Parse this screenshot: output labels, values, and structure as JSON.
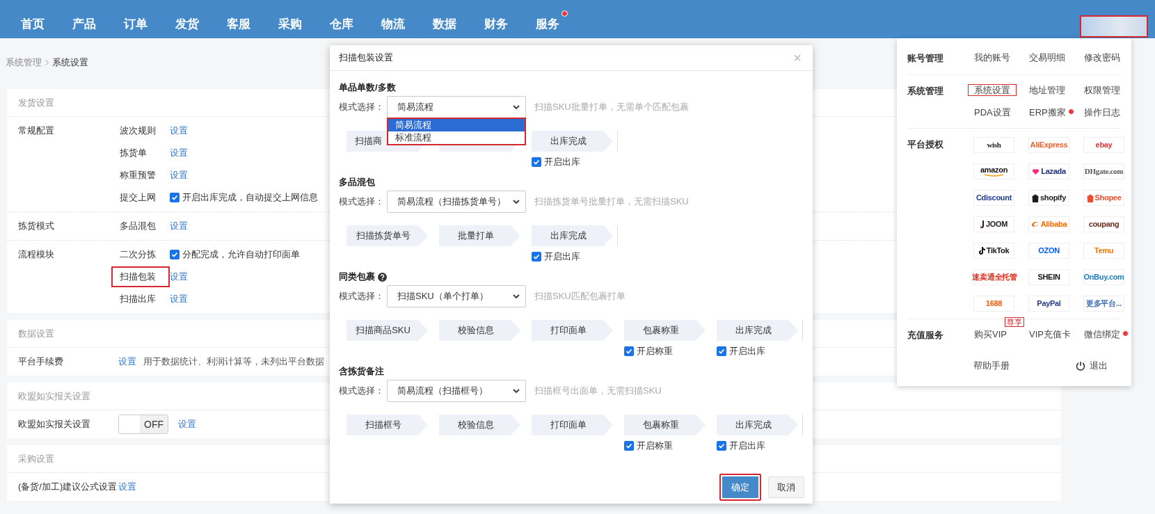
{
  "nav": {
    "items": [
      {
        "label": "首页",
        "dot": false
      },
      {
        "label": "产品",
        "dot": false
      },
      {
        "label": "订单",
        "dot": false
      },
      {
        "label": "发货",
        "dot": false
      },
      {
        "label": "客服",
        "dot": false
      },
      {
        "label": "采购",
        "dot": false
      },
      {
        "label": "仓库",
        "dot": false
      },
      {
        "label": "物流",
        "dot": false
      },
      {
        "label": "数据",
        "dot": false
      },
      {
        "label": "财务",
        "dot": false
      },
      {
        "label": "服务",
        "dot": true
      }
    ],
    "account": {
      "highlighted": true
    }
  },
  "breadcrumb": [
    {
      "label": "系统管理",
      "current": false
    },
    {
      "label": "系统设置",
      "current": true
    }
  ],
  "sections": [
    {
      "title": "发货设置",
      "groups": [
        {
          "label": "常规配置",
          "rows": [
            {
              "kind": "link",
              "name": "波次规则",
              "link": "设置"
            },
            {
              "kind": "link",
              "name": "拣货单",
              "link": "设置"
            },
            {
              "kind": "link",
              "name": "称重预警",
              "link": "设置"
            },
            {
              "kind": "check",
              "name": "提交上网",
              "checked": true,
              "text": "开启出库完成，自动提交上网信息"
            }
          ]
        },
        {
          "label": "拣货模式",
          "rows": [
            {
              "kind": "link",
              "name": "多品混包",
              "link": "设置"
            }
          ]
        },
        {
          "label": "流程模块",
          "rows": [
            {
              "kind": "check",
              "name": "二次分拣",
              "checked": true,
              "text": "分配完成，允许自动打印面单"
            },
            {
              "kind": "link",
              "name": "扫描包装",
              "link": "设置",
              "highlighted": true
            },
            {
              "kind": "link",
              "name": "扫描出库",
              "link": "设置"
            }
          ]
        }
      ]
    },
    {
      "title": "数据设置",
      "groups": [
        {
          "label": "平台手续费",
          "rows": [
            {
              "kind": "note",
              "link": "设置",
              "text": "用于数据统计、利润计算等，未列出平台数据"
            }
          ]
        }
      ]
    },
    {
      "title": "欧盟如实报关设置",
      "groups": [
        {
          "label": "欧盟如实报关设置",
          "rows": [
            {
              "kind": "toggle",
              "on": false,
              "toggle_label": "OFF",
              "link": "设置"
            }
          ]
        }
      ]
    },
    {
      "title": "采购设置",
      "groups": [
        {
          "label": "(备货/加工)建议公式设置",
          "rows": [
            {
              "kind": "note",
              "link": "设置"
            }
          ]
        }
      ]
    }
  ],
  "modal": {
    "title": "扫描包装设置",
    "close": "×",
    "sections": [
      {
        "title": "单品单数/多数",
        "help": false,
        "mode_label": "模式选择：",
        "select": "简易流程",
        "hint": "扫描SKU批量打单，无需单个匹配包裹",
        "options": {
          "highlighted": true,
          "items": [
            {
              "label": "简易流程",
              "selected": true
            },
            {
              "label": "标准流程",
              "selected": false
            }
          ]
        },
        "steps": [
          {
            "kind": "cut",
            "label": "扫描商"
          },
          {
            "kind": "blank"
          },
          {
            "kind": "step",
            "label": "出库完成",
            "option": {
              "label": "开启出库",
              "checked": true
            }
          }
        ]
      },
      {
        "title": "多品混包",
        "help": false,
        "mode_label": "模式选择：",
        "select": "简易流程（扫描拣货单号）",
        "hint": "扫描拣货单号批量打单，无需扫描SKU",
        "steps": [
          {
            "kind": "step",
            "label": "扫描拣货单号"
          },
          {
            "kind": "step",
            "label": "批量打单"
          },
          {
            "kind": "step",
            "label": "出库完成",
            "option": {
              "label": "开启出库",
              "checked": true
            }
          }
        ]
      },
      {
        "title": "同类包裹",
        "help": true,
        "mode_label": "模式选择：",
        "select": "扫描SKU（单个打单）",
        "hint": "扫描SKU匹配包裹打单",
        "steps": [
          {
            "kind": "step",
            "label": "扫描商品SKU"
          },
          {
            "kind": "step",
            "label": "校验信息"
          },
          {
            "kind": "step",
            "label": "打印面单"
          },
          {
            "kind": "step",
            "label": "包裹称重",
            "option": {
              "label": "开启称重",
              "checked": true
            }
          },
          {
            "kind": "step",
            "label": "出库完成",
            "option": {
              "label": "开启出库",
              "checked": true
            }
          }
        ]
      },
      {
        "title": "含拣货备注",
        "help": false,
        "mode_label": "模式选择：",
        "select": "简易流程（扫描框号）",
        "hint": "扫描框号出面单，无需扫描SKU",
        "steps": [
          {
            "kind": "step",
            "label": "扫描框号"
          },
          {
            "kind": "step",
            "label": "校验信息"
          },
          {
            "kind": "step",
            "label": "打印面单"
          },
          {
            "kind": "step",
            "label": "包裹称重",
            "option": {
              "label": "开启称重",
              "checked": true
            }
          },
          {
            "kind": "step",
            "label": "出库完成",
            "option": {
              "label": "开启出库",
              "checked": true
            }
          }
        ]
      }
    ],
    "buttons": [
      {
        "label": "确定",
        "kind": "primary",
        "highlighted": true
      },
      {
        "label": "取消",
        "kind": "default",
        "highlighted": false
      }
    ]
  },
  "account_menu": {
    "groups": [
      {
        "label": "账号管理",
        "kind": "links",
        "items": [
          {
            "label": "我的账号",
            "highlighted": false,
            "dot": false
          },
          {
            "label": "交易明细",
            "highlighted": false,
            "dot": false
          },
          {
            "label": "修改密码",
            "highlighted": false,
            "dot": false
          }
        ]
      },
      {
        "label": "系统管理",
        "kind": "links",
        "items": [
          {
            "label": "系统设置",
            "highlighted": true,
            "dot": false
          },
          {
            "label": "地址管理",
            "highlighted": false,
            "dot": false
          },
          {
            "label": "权限管理",
            "highlighted": false,
            "dot": false
          },
          {
            "label": "PDA设置",
            "highlighted": false,
            "dot": false
          },
          {
            "label": "ERP搬家",
            "highlighted": false,
            "dot": true
          },
          {
            "label": "操作日志",
            "highlighted": false,
            "dot": false
          }
        ]
      },
      {
        "label": "平台授权",
        "kind": "logos",
        "items": [
          {
            "label": "wish",
            "color": "#222222",
            "kind": "serif"
          },
          {
            "label": "AliExpress",
            "color": "#f0602a",
            "kind": "text"
          },
          {
            "label": "ebay",
            "color": "#e53238",
            "kind": "text"
          },
          {
            "label": "amazon",
            "color": "#111111",
            "kind": "smile"
          },
          {
            "label": "Lazada",
            "color": "#1b2a78",
            "kind": "heart"
          },
          {
            "label": "DHgate.com",
            "color": "#555555",
            "kind": "serif"
          },
          {
            "label": "Cdiscount",
            "color": "#1d3c8f",
            "kind": "text"
          },
          {
            "label": "shopify",
            "color": "#1a1a1a",
            "kind": "bag"
          },
          {
            "label": "Shopee",
            "color": "#ee4d2d",
            "kind": "bag"
          },
          {
            "label": "JOOM",
            "color": "#222222",
            "kind": "bar"
          },
          {
            "label": "Alibaba",
            "color": "#ff6a00",
            "kind": "swoosh"
          },
          {
            "label": "coupang",
            "color": "#6b2a1a",
            "kind": "text"
          },
          {
            "label": "TikTok",
            "color": "#111111",
            "kind": "note"
          },
          {
            "label": "OZON",
            "color": "#005bff",
            "kind": "text"
          },
          {
            "label": "Temu",
            "color": "#fb7701",
            "kind": "text"
          },
          {
            "label": "速卖通全托管",
            "color": "#e0311c",
            "kind": "square"
          },
          {
            "label": "SHEIN",
            "color": "#111111",
            "kind": "text"
          },
          {
            "label": "OnBuy.com",
            "color": "#1a7fc1",
            "kind": "text"
          },
          {
            "label": "1688",
            "color": "#ff5a00",
            "kind": "text"
          },
          {
            "label": "PayPal",
            "color": "#253b80",
            "kind": "text"
          },
          {
            "label": "更多平台...",
            "color": "#3b6fb6",
            "kind": "text"
          }
        ]
      },
      {
        "label": "充值服务",
        "kind": "links",
        "items": [
          {
            "label": "购买VIP",
            "highlighted": false,
            "dot": false,
            "badge": "尊享"
          },
          {
            "label": "VIP充值卡",
            "highlighted": false,
            "dot": false
          },
          {
            "label": "微信绑定",
            "highlighted": false,
            "dot": true
          }
        ]
      },
      {
        "kind": "footer",
        "help": "帮助手册",
        "logout": "退出"
      }
    ]
  }
}
